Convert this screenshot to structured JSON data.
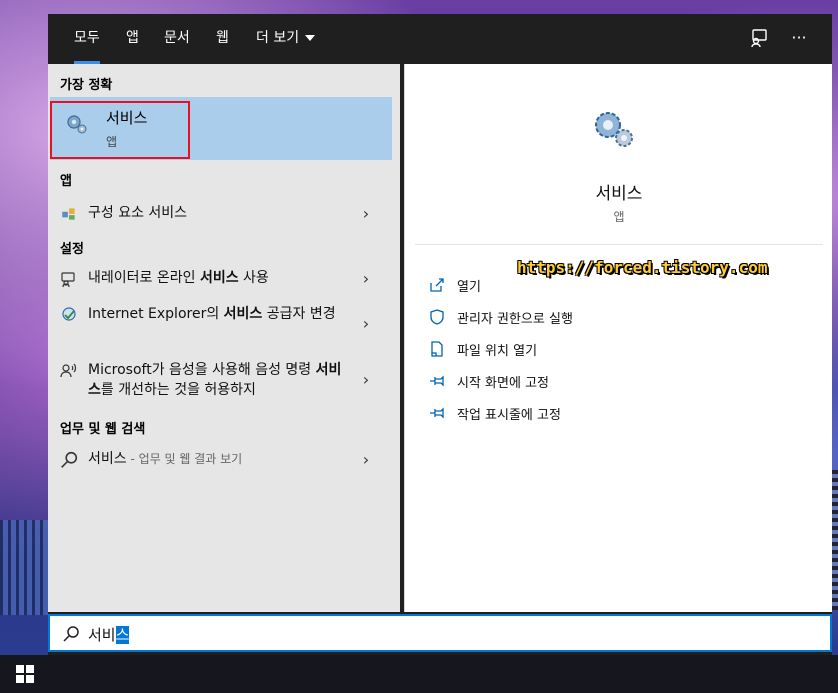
{
  "tabs": [
    {
      "label": "모두",
      "active": true
    },
    {
      "label": "앱"
    },
    {
      "label": "문서"
    },
    {
      "label": "웹"
    },
    {
      "label": "더 보기"
    }
  ],
  "top_icons": [
    "feedback-icon",
    "more-options-icon"
  ],
  "top_more_glyph": "···",
  "sections": {
    "best_match": "가장 정확",
    "apps": "앱",
    "settings": "설정",
    "web": "업무 및 웹 검색"
  },
  "best_match": {
    "title": "서비스",
    "subtitle": "앱"
  },
  "apps": [
    {
      "label": "구성 요소 서비스"
    }
  ],
  "settings": [
    {
      "pre": "내레이터로 온라인 ",
      "bold": "서비스",
      "post": " 사용"
    },
    {
      "pre": "Internet Explorer의 ",
      "bold": "서비스",
      "post": " 공급자 변경"
    },
    {
      "pre": "Microsoft가 음성을 사용해 음성 명령 ",
      "bold": "서비스",
      "post": "를 개선하는 것을 허용하지"
    }
  ],
  "web": {
    "query": "서비스",
    "suffix": " - 업무 및 웹 결과 보기"
  },
  "preview": {
    "title": "서비스",
    "subtitle": "앱",
    "actions": [
      "열기",
      "관리자 권한으로 실행",
      "파일 위치 열기",
      "시작 화면에 고정",
      "작업 표시줄에 고정"
    ]
  },
  "watermark": "https://forced.tistory.com",
  "search": {
    "text_plain": "서비",
    "text_selected": "스"
  },
  "colors": {
    "accent": "#0078d7",
    "highlight_border": "#e81123",
    "best_bg": "#a9cdea"
  }
}
